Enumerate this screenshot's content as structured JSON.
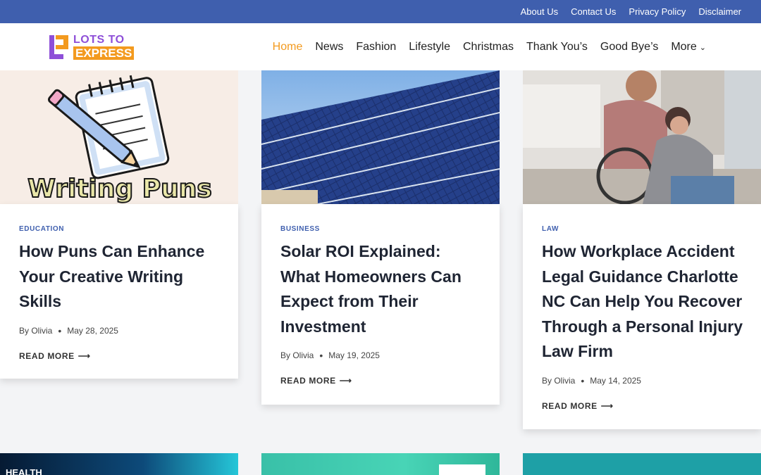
{
  "topbar": {
    "links": [
      "About Us",
      "Contact Us",
      "Privacy Policy",
      "Disclaimer"
    ]
  },
  "logo": {
    "top": "LOTS TO",
    "bottom": "EXPRESS"
  },
  "nav": {
    "items": [
      "Home",
      "News",
      "Fashion",
      "Lifestyle",
      "Christmas",
      "Thank You’s",
      "Good Bye’s",
      "More"
    ],
    "active": "Home"
  },
  "posts": [
    {
      "category": "EDUCATION",
      "title": "How Puns Can Enhance Your Creative Writing Skills",
      "author": "By Olivia",
      "date": "May 28, 2025",
      "read_more": "READ MORE",
      "image_text": "Writing Puns"
    },
    {
      "category": "BUSINESS",
      "title": "Solar ROI Explained: What Homeowners Can Expect from Their Investment",
      "author": "By Olivia",
      "date": "May 19, 2025",
      "read_more": "READ MORE"
    },
    {
      "category": "LAW",
      "title": "How Workplace Accident Legal Guidance Charlotte NC Can Help You Recover Through a Personal Injury Law Firm",
      "author": "By Olivia",
      "date": "May 14, 2025",
      "read_more": "READ MORE"
    }
  ],
  "bottom_row": {
    "first_image_text": "HEALTH"
  },
  "colors": {
    "topbar": "#3f5fae",
    "accent": "#f39a1e",
    "logo_purple": "#8e4fd8",
    "category": "#3f5fae"
  }
}
